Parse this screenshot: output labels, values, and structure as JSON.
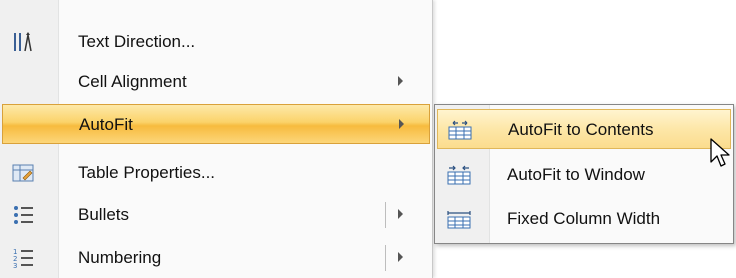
{
  "menu": {
    "items": [
      {
        "label": "Text Direction...",
        "icon": "text-direction-icon",
        "has_submenu": false
      },
      {
        "label": "Cell Alignment",
        "icon": null,
        "has_submenu": true
      },
      {
        "label": "AutoFit",
        "icon": null,
        "has_submenu": true,
        "highlighted": true
      },
      {
        "label": "Table Properties...",
        "icon": "table-properties-icon",
        "has_submenu": false
      },
      {
        "label": "Bullets",
        "icon": "bullets-icon",
        "has_submenu": true,
        "split": true
      },
      {
        "label": "Numbering",
        "icon": "numbering-icon",
        "has_submenu": true,
        "split": true
      }
    ]
  },
  "submenu": {
    "items": [
      {
        "label": "AutoFit to Contents",
        "icon": "autofit-contents-icon",
        "highlighted": true
      },
      {
        "label": "AutoFit to Window",
        "icon": "autofit-window-icon"
      },
      {
        "label": "Fixed Column Width",
        "icon": "fixed-column-width-icon"
      }
    ]
  },
  "colors": {
    "highlight": "#f7bb3e",
    "sub_highlight": "#fde7a8",
    "icon_blue": "#3a6fb0"
  }
}
